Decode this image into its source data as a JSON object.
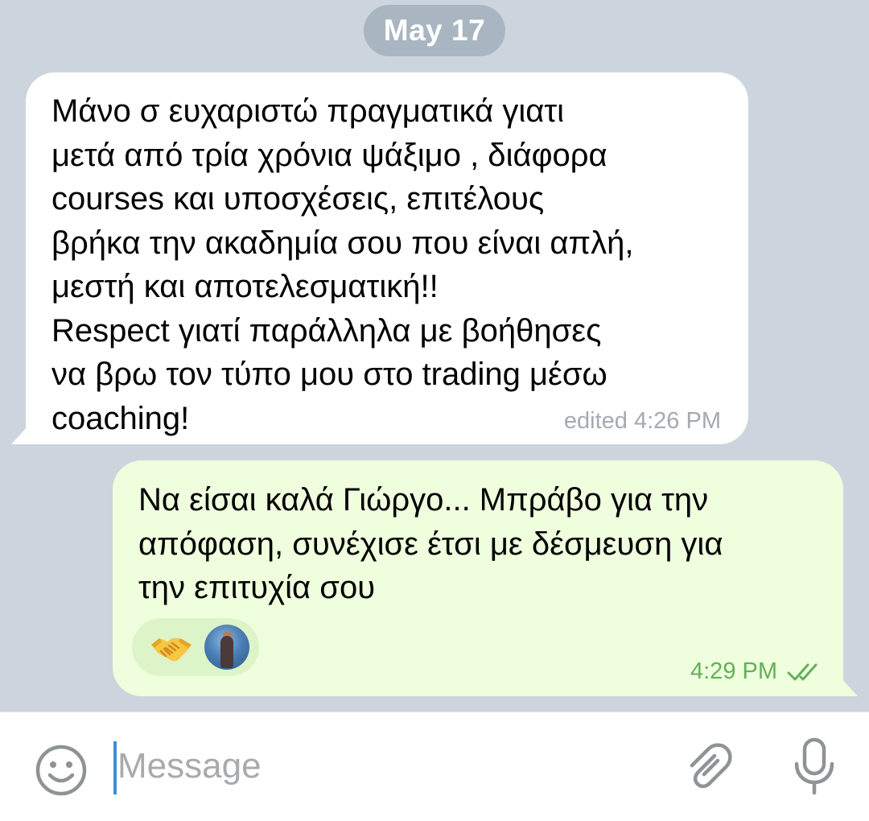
{
  "chat": {
    "date_separator": "May 17",
    "messages": [
      {
        "direction": "incoming",
        "text": "Μάνο σ ευχαριστώ πραγματικά γιατι\nμετά από τρία χρόνια ψάξιμο ,  διάφορα\ncourses και υποσχέσεις, επιτέλους\nβρήκα την ακαδημία σου που είναι απλή,\nμεστή και αποτελεσματική!!\nRespect γιατί παράλληλα με βοήθησες\nνα βρω τον τύπο μου στο trading μέσω\ncoaching!",
        "meta": "edited 4:26 PM"
      },
      {
        "direction": "outgoing",
        "text": "Να είσαι καλά Γιώργο... Μπράβο για την\nαπόφαση, συνέχισε έτσι με δέσμευση για\nτην επιτυχία σου",
        "time": "4:29 PM",
        "status_icon": "double-check-icon",
        "reaction": {
          "emoji_icon": "handshake-emoji",
          "reactor_avatar": "avatar"
        }
      }
    ]
  },
  "composer": {
    "placeholder": "Message",
    "emoji_icon": "smiley-icon",
    "attach_icon": "paperclip-icon",
    "mic_icon": "microphone-icon"
  },
  "colors": {
    "chat_background": "#ccd5dd",
    "incoming_bubble": "#ffffff",
    "outgoing_bubble": "#effedd",
    "outgoing_meta": "#62b05a",
    "date_pill": "#a9b6c1",
    "cursor": "#3b8fd8",
    "icon_gray": "#8e9396"
  }
}
